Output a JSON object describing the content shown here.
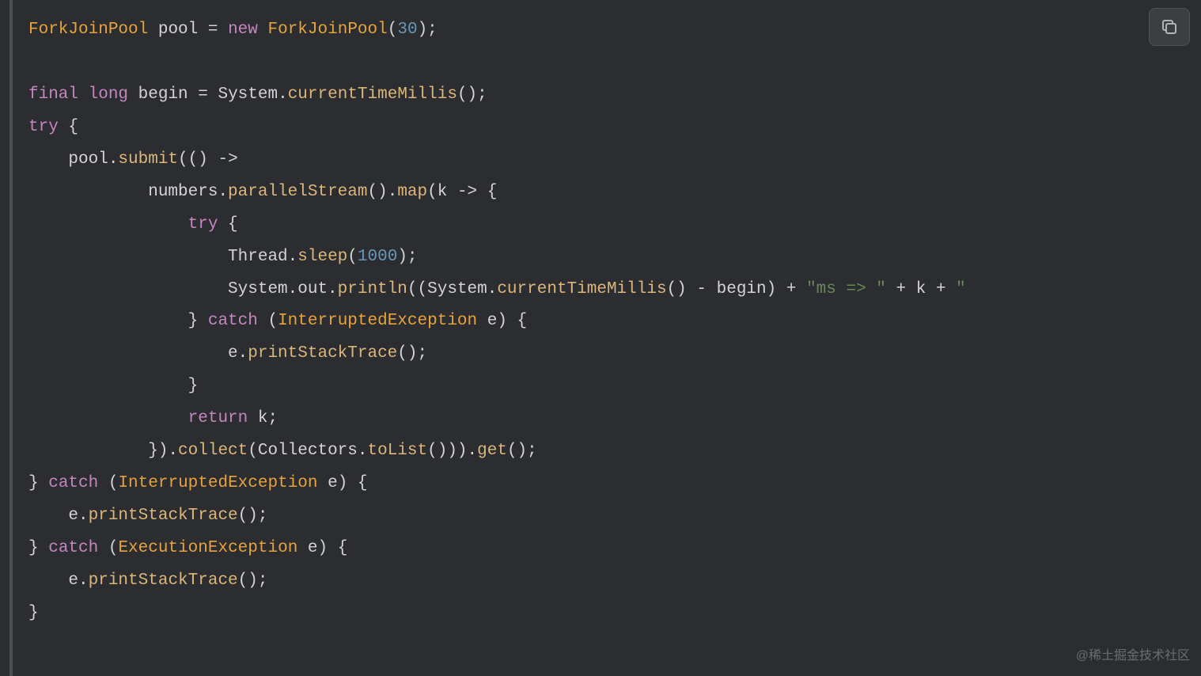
{
  "code": {
    "lines": [
      [
        {
          "cls": "type",
          "t": "ForkJoinPool"
        },
        {
          "cls": "punct",
          "t": " pool "
        },
        {
          "cls": "op",
          "t": "="
        },
        {
          "cls": "punct",
          "t": " "
        },
        {
          "cls": "new-kw",
          "t": "new"
        },
        {
          "cls": "punct",
          "t": " "
        },
        {
          "cls": "type",
          "t": "ForkJoinPool"
        },
        {
          "cls": "paren",
          "t": "("
        },
        {
          "cls": "number",
          "t": "30"
        },
        {
          "cls": "paren",
          "t": ")"
        },
        {
          "cls": "punct",
          "t": ";"
        }
      ],
      [],
      [
        {
          "cls": "final-kw",
          "t": "final"
        },
        {
          "cls": "punct",
          "t": " "
        },
        {
          "cls": "keyword",
          "t": "long"
        },
        {
          "cls": "punct",
          "t": " begin "
        },
        {
          "cls": "op",
          "t": "="
        },
        {
          "cls": "punct",
          "t": " System."
        },
        {
          "cls": "method",
          "t": "currentTimeMillis"
        },
        {
          "cls": "paren",
          "t": "()"
        },
        {
          "cls": "punct",
          "t": ";"
        }
      ],
      [
        {
          "cls": "try-kw",
          "t": "try"
        },
        {
          "cls": "punct",
          "t": " {"
        }
      ],
      [
        {
          "cls": "punct",
          "t": "    pool."
        },
        {
          "cls": "method",
          "t": "submit"
        },
        {
          "cls": "paren",
          "t": "(()"
        },
        {
          "cls": "punct",
          "t": " "
        },
        {
          "cls": "arrow",
          "t": "->"
        }
      ],
      [
        {
          "cls": "punct",
          "t": "            numbers."
        },
        {
          "cls": "method",
          "t": "parallelStream"
        },
        {
          "cls": "paren",
          "t": "()"
        },
        {
          "cls": "punct",
          "t": "."
        },
        {
          "cls": "method",
          "t": "map"
        },
        {
          "cls": "paren",
          "t": "("
        },
        {
          "cls": "punct",
          "t": "k "
        },
        {
          "cls": "arrow",
          "t": "->"
        },
        {
          "cls": "punct",
          "t": " {"
        }
      ],
      [
        {
          "cls": "punct",
          "t": "                "
        },
        {
          "cls": "try-kw",
          "t": "try"
        },
        {
          "cls": "punct",
          "t": " {"
        }
      ],
      [
        {
          "cls": "punct",
          "t": "                    Thread."
        },
        {
          "cls": "method",
          "t": "sleep"
        },
        {
          "cls": "paren",
          "t": "("
        },
        {
          "cls": "number",
          "t": "1000"
        },
        {
          "cls": "paren",
          "t": ")"
        },
        {
          "cls": "punct",
          "t": ";"
        }
      ],
      [
        {
          "cls": "punct",
          "t": "                    System.out."
        },
        {
          "cls": "method",
          "t": "println"
        },
        {
          "cls": "paren",
          "t": "(("
        },
        {
          "cls": "punct",
          "t": "System."
        },
        {
          "cls": "method",
          "t": "currentTimeMillis"
        },
        {
          "cls": "paren",
          "t": "()"
        },
        {
          "cls": "punct",
          "t": " "
        },
        {
          "cls": "op",
          "t": "-"
        },
        {
          "cls": "punct",
          "t": " begin"
        },
        {
          "cls": "paren",
          "t": ")"
        },
        {
          "cls": "punct",
          "t": " "
        },
        {
          "cls": "op",
          "t": "+"
        },
        {
          "cls": "punct",
          "t": " "
        },
        {
          "cls": "string",
          "t": "\"ms => \""
        },
        {
          "cls": "punct",
          "t": " "
        },
        {
          "cls": "op",
          "t": "+"
        },
        {
          "cls": "punct",
          "t": " k "
        },
        {
          "cls": "op",
          "t": "+"
        },
        {
          "cls": "punct",
          "t": " "
        },
        {
          "cls": "string",
          "t": "\""
        }
      ],
      [
        {
          "cls": "punct",
          "t": "                } "
        },
        {
          "cls": "catch-kw",
          "t": "catch"
        },
        {
          "cls": "punct",
          "t": " "
        },
        {
          "cls": "paren",
          "t": "("
        },
        {
          "cls": "type",
          "t": "InterruptedException"
        },
        {
          "cls": "punct",
          "t": " e"
        },
        {
          "cls": "paren",
          "t": ")"
        },
        {
          "cls": "punct",
          "t": " {"
        }
      ],
      [
        {
          "cls": "punct",
          "t": "                    e."
        },
        {
          "cls": "method",
          "t": "printStackTrace"
        },
        {
          "cls": "paren",
          "t": "()"
        },
        {
          "cls": "punct",
          "t": ";"
        }
      ],
      [
        {
          "cls": "punct",
          "t": "                }"
        }
      ],
      [
        {
          "cls": "punct",
          "t": "                "
        },
        {
          "cls": "return-kw",
          "t": "return"
        },
        {
          "cls": "punct",
          "t": " k;"
        }
      ],
      [
        {
          "cls": "punct",
          "t": "            })."
        },
        {
          "cls": "method",
          "t": "collect"
        },
        {
          "cls": "paren",
          "t": "("
        },
        {
          "cls": "punct",
          "t": "Collectors."
        },
        {
          "cls": "method",
          "t": "toList"
        },
        {
          "cls": "paren",
          "t": "()))"
        },
        {
          "cls": "punct",
          "t": "."
        },
        {
          "cls": "method",
          "t": "get"
        },
        {
          "cls": "paren",
          "t": "()"
        },
        {
          "cls": "punct",
          "t": ";"
        }
      ],
      [
        {
          "cls": "punct",
          "t": "} "
        },
        {
          "cls": "catch-kw",
          "t": "catch"
        },
        {
          "cls": "punct",
          "t": " "
        },
        {
          "cls": "paren",
          "t": "("
        },
        {
          "cls": "type",
          "t": "InterruptedException"
        },
        {
          "cls": "punct",
          "t": " e"
        },
        {
          "cls": "paren",
          "t": ")"
        },
        {
          "cls": "punct",
          "t": " {"
        }
      ],
      [
        {
          "cls": "punct",
          "t": "    e."
        },
        {
          "cls": "method",
          "t": "printStackTrace"
        },
        {
          "cls": "paren",
          "t": "()"
        },
        {
          "cls": "punct",
          "t": ";"
        }
      ],
      [
        {
          "cls": "punct",
          "t": "} "
        },
        {
          "cls": "catch-kw",
          "t": "catch"
        },
        {
          "cls": "punct",
          "t": " "
        },
        {
          "cls": "paren",
          "t": "("
        },
        {
          "cls": "type",
          "t": "ExecutionException"
        },
        {
          "cls": "punct",
          "t": " e"
        },
        {
          "cls": "paren",
          "t": ")"
        },
        {
          "cls": "punct",
          "t": " {"
        }
      ],
      [
        {
          "cls": "punct",
          "t": "    e."
        },
        {
          "cls": "method",
          "t": "printStackTrace"
        },
        {
          "cls": "paren",
          "t": "()"
        },
        {
          "cls": "punct",
          "t": ";"
        }
      ],
      [
        {
          "cls": "punct",
          "t": "}"
        }
      ]
    ]
  },
  "watermark": "@稀土掘金技术社区",
  "copyButton": {
    "label": "copy"
  }
}
